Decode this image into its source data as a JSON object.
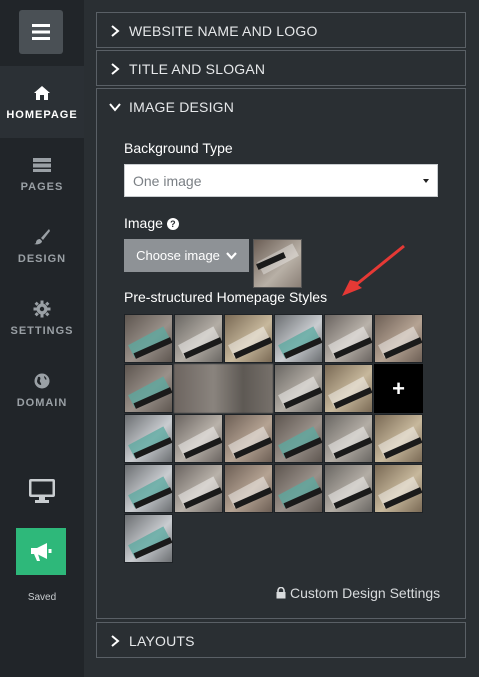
{
  "sidebar": {
    "items": [
      {
        "label": "HOMEPAGE",
        "icon": "home-icon",
        "active": true
      },
      {
        "label": "PAGES",
        "icon": "pages-icon",
        "active": false
      },
      {
        "label": "DESIGN",
        "icon": "brush-icon",
        "active": false
      },
      {
        "label": "SETTINGS",
        "icon": "gear-icon",
        "active": false
      },
      {
        "label": "DOMAIN",
        "icon": "globe-icon",
        "active": false
      }
    ],
    "saved_label": "Saved"
  },
  "panels": {
    "website_name": "WEBSITE NAME AND LOGO",
    "title_slogan": "TITLE AND SLOGAN",
    "image_design": "IMAGE DESIGN",
    "layouts": "LAYOUTS"
  },
  "image_design": {
    "background_type_label": "Background Type",
    "background_type_value": "One image",
    "image_label": "Image",
    "help_glyph": "?",
    "choose_image_label": "Choose image",
    "styles_label": "Pre-structured Homepage Styles",
    "add_glyph": "+",
    "custom_design_label": "Custom Design Settings"
  },
  "colors": {
    "accent_green": "#2eb87a",
    "sidebar_bg": "#212529",
    "panel_bg": "#2a2f33",
    "arrow_red": "#e53935"
  }
}
